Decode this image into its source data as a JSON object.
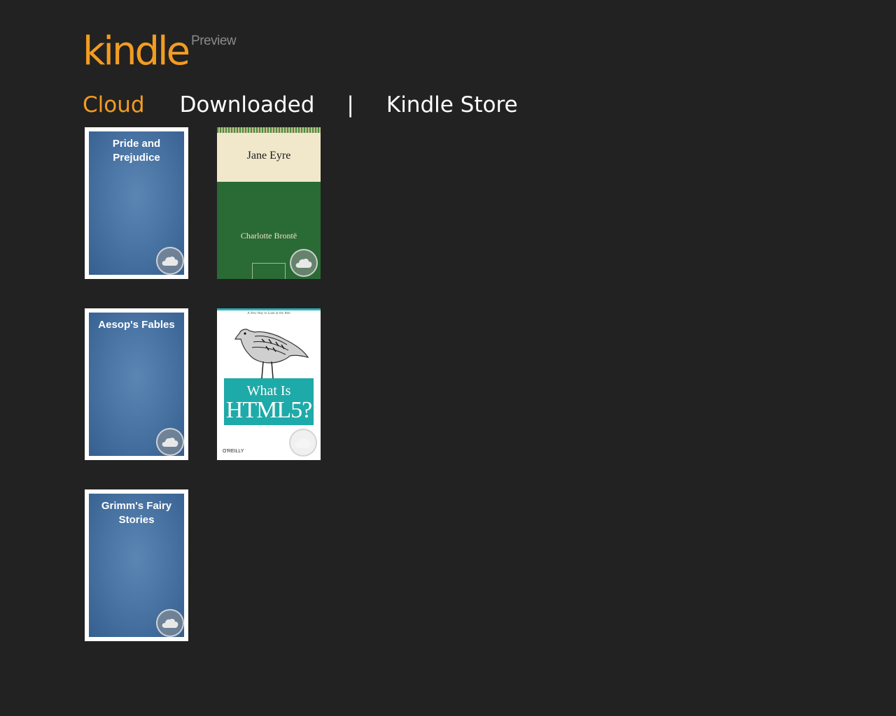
{
  "app": {
    "logo_main": "kindle",
    "logo_sub": "Preview"
  },
  "nav": {
    "cloud": "Cloud",
    "downloaded": "Downloaded",
    "separator": "|",
    "store": "Kindle Store",
    "active": "cloud"
  },
  "books": [
    {
      "title": "Pride and Prejudice",
      "status_icon": "cloud-icon"
    },
    {
      "title": "Jane Eyre",
      "author": "Charlotte Brontë",
      "status_icon": "cloud-icon"
    },
    {
      "title": "Aesop's Fables",
      "status_icon": "cloud-icon"
    },
    {
      "tagline": "A New Way to Look at the Web",
      "title_line1": "What Is",
      "title_line2": "HTML5?",
      "publisher": "O'REILLY",
      "status_icon": "cloud-icon"
    },
    {
      "title": "Grimm's Fairy Stories",
      "status_icon": "cloud-icon"
    }
  ],
  "colors": {
    "background": "#222222",
    "accent": "#f39c22",
    "cover_blue": "#4a75a4"
  }
}
